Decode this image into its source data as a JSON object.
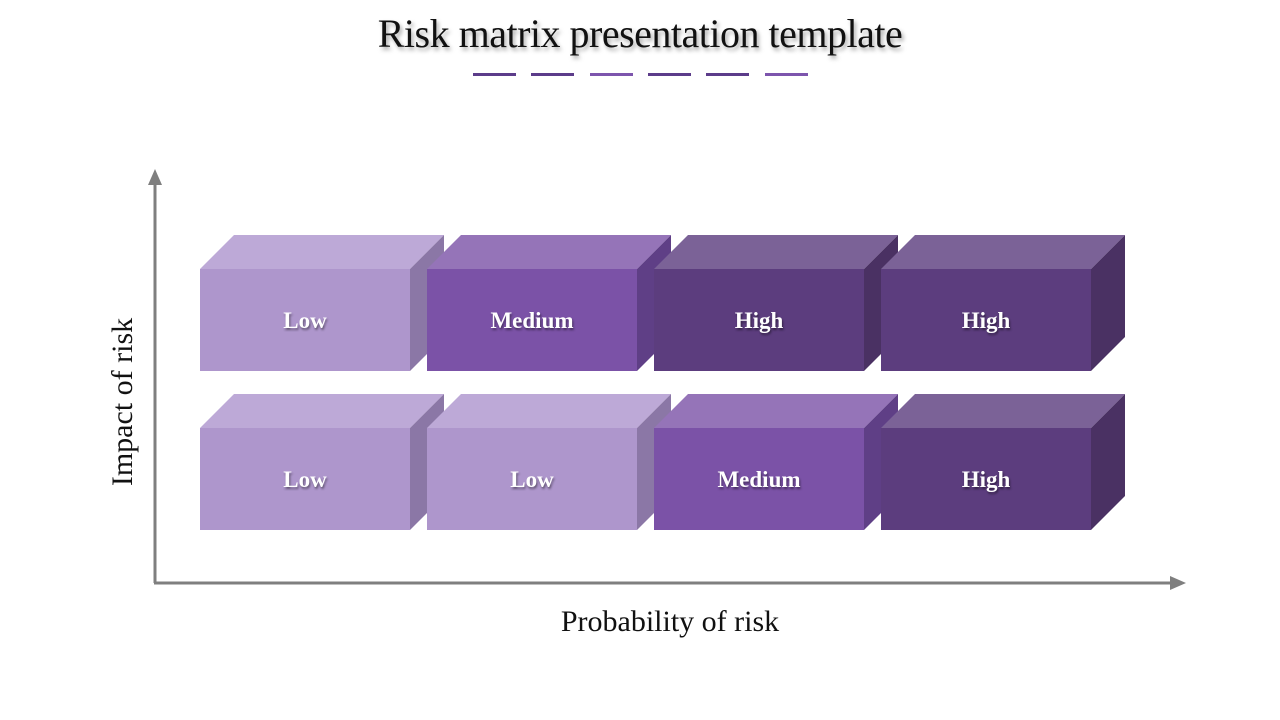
{
  "title": "Risk matrix presentation template",
  "dashes": [
    "#5c3c8a",
    "#5c3c8a",
    "#7d55ad",
    "#5c3c8a",
    "#5c3c8a",
    "#7d55ad"
  ],
  "axes": {
    "y_label": "Impact of risk",
    "x_label": "Probability of risk",
    "color": "#7f7f7f"
  },
  "levels": {
    "Low": {
      "front": "#ae96cc",
      "top": "#bda9d7",
      "side": "#8b77a6"
    },
    "Medium": {
      "front": "#7b52a7",
      "top": "#9574b8",
      "side": "#5f3f86"
    },
    "High": {
      "front": "#5c3d7e",
      "top": "#7b6297",
      "side": "#4a3163"
    }
  },
  "matrix": {
    "rows": [
      [
        "Low",
        "Medium",
        "High",
        "High"
      ],
      [
        "Low",
        "Low",
        "Medium",
        "High"
      ]
    ]
  }
}
